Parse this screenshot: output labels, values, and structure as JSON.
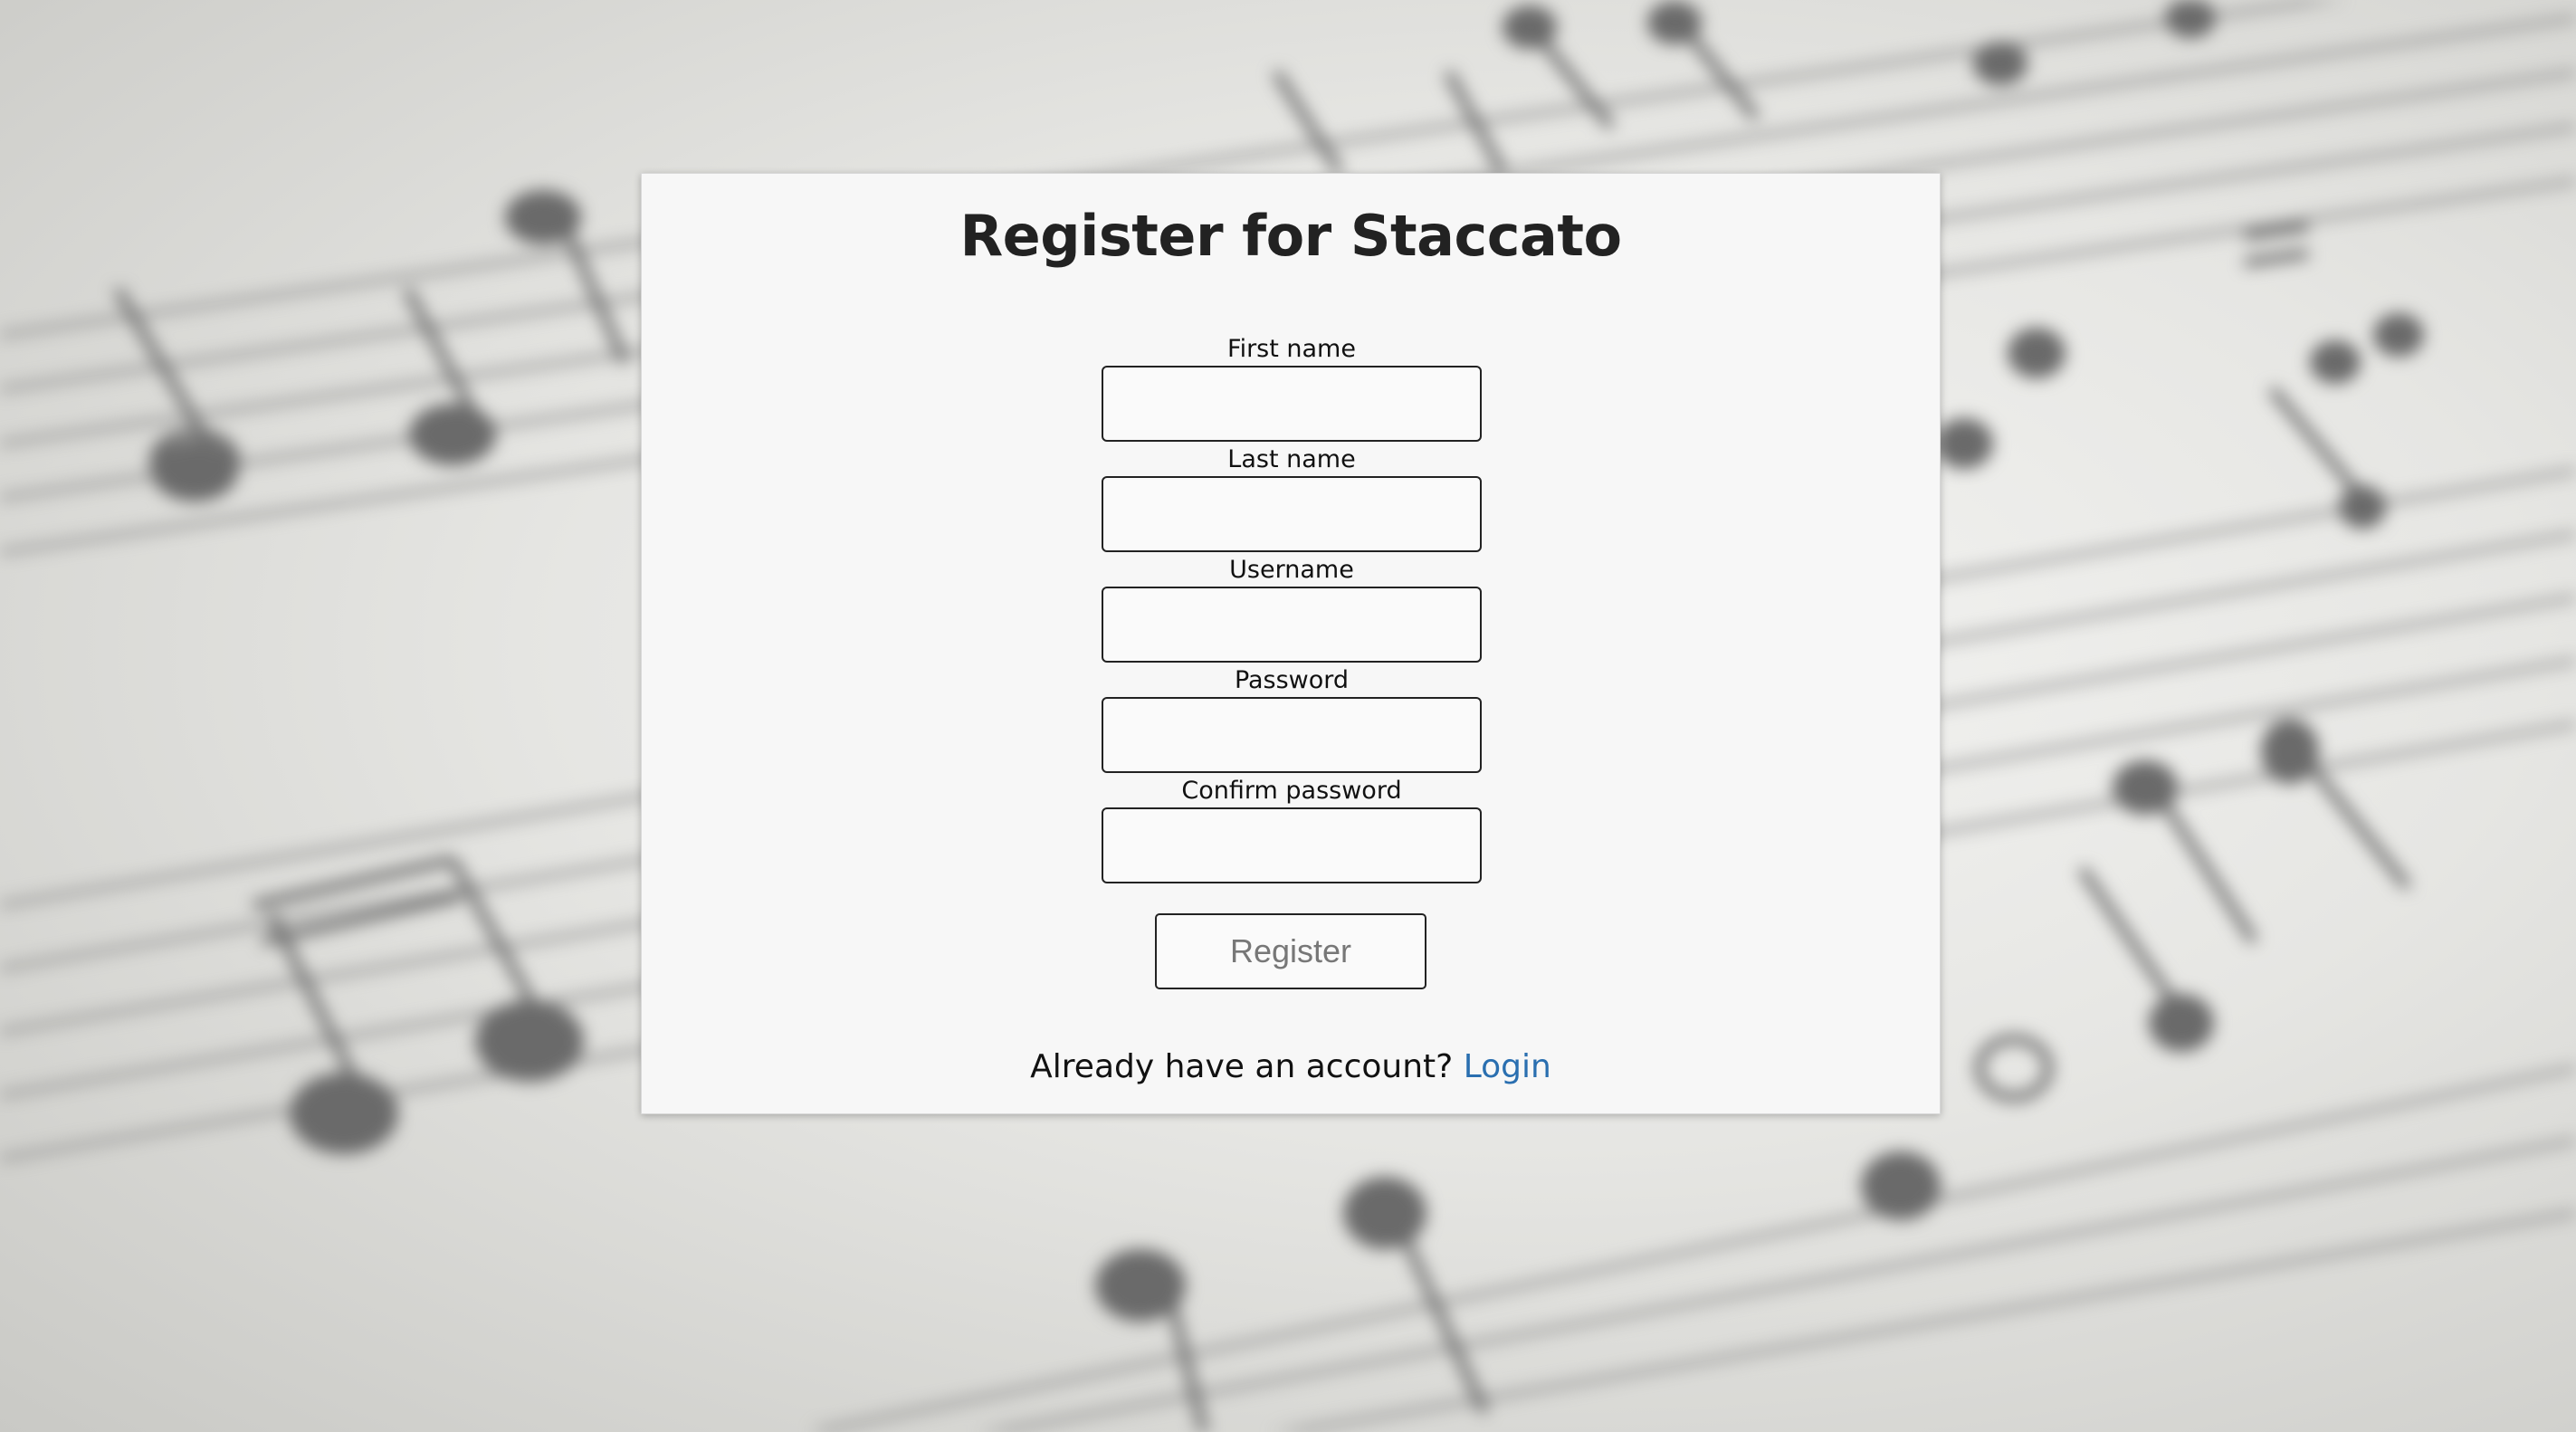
{
  "page": {
    "title": "Register for Staccato"
  },
  "form": {
    "fields": [
      {
        "label": "First name",
        "value": "",
        "placeholder": ""
      },
      {
        "label": "Last name",
        "value": "",
        "placeholder": ""
      },
      {
        "label": "Username",
        "value": "",
        "placeholder": ""
      },
      {
        "label": "Password",
        "value": "",
        "placeholder": ""
      },
      {
        "label": "Confirm password",
        "value": "",
        "placeholder": ""
      }
    ],
    "submit_label": "Register"
  },
  "footer": {
    "prompt": "Already have an account?",
    "login_label": "Login"
  },
  "colors": {
    "card_background": "#f7f7f7",
    "link": "#2a6fb0",
    "button_text": "#777777"
  },
  "background": {
    "description_icon": "sheet-music-background"
  }
}
